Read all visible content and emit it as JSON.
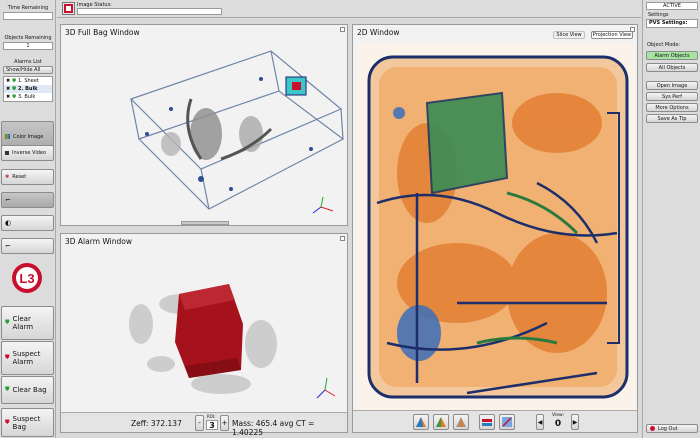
{
  "left": {
    "time_remaining_label": "Time Remaining",
    "objects_remaining_label": "Objects Remaining",
    "objects_remaining_value": "1",
    "alarms_list_label": "Alarms List",
    "show_hide_all": "Show/Hide All",
    "alarms": [
      {
        "label": "1. Sheet",
        "checked": true,
        "bold": false
      },
      {
        "label": "2. Bulk",
        "checked": true,
        "bold": true
      },
      {
        "label": "3. Bulk",
        "checked": true,
        "bold": false
      }
    ],
    "color_image": "Color Image",
    "inverse_video": "Inverse Video",
    "reset": "Reset",
    "clear_alarm": "Clear Alarm",
    "suspect_alarm": "Suspect Alarm",
    "clear_bag": "Clear Bag",
    "suspect_bag": "Suspect Bag",
    "logo_text": "L3"
  },
  "top": {
    "image_status_label": "Image Status:"
  },
  "full_bag": {
    "title": "3D Full Bag Window"
  },
  "alarm_window": {
    "title": "3D Alarm Window",
    "zeff": "Zeff: 372.137",
    "roi_label": "ROI:",
    "roi_value": "3",
    "minus": "-",
    "plus": "+",
    "mass": "Mass: 465.4 avg CT = 1.40225"
  },
  "window2d": {
    "title": "2D Window",
    "slice_view": "Slice View",
    "projection_view": "Projection View",
    "view_label": "View:",
    "view_value": "0"
  },
  "right": {
    "status": "ACTIVE",
    "settings_label": "Settings",
    "pvs_settings": "PVS Settings:",
    "object_mode_label": "Object Mode:",
    "alarm_objects": "Alarm Objects",
    "all_objects": "All Objects",
    "open_image": "Open Image",
    "sys_perf": "Sys Perf",
    "more_options": "More Options",
    "save_as_tip": "Save As Tip",
    "log_out": "Log Out"
  },
  "colors": {
    "accent_green": "#a6e3a0",
    "suspect_red": "#c8102e",
    "clear_green": "#2a9d3a"
  }
}
